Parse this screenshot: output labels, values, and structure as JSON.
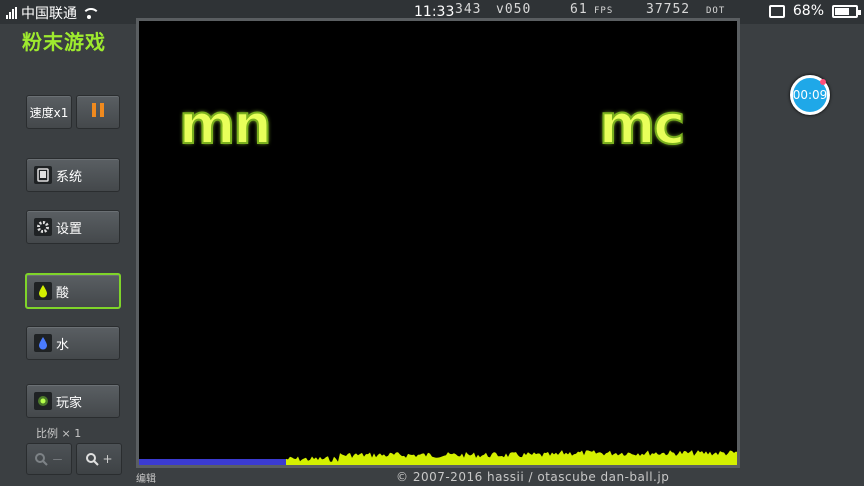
{
  "status_bar": {
    "carrier": "中国联通",
    "time": "11:33",
    "particles": "343",
    "version": "v050",
    "fps_value": "61",
    "fps_unit": "FPS",
    "dot_value": "37752",
    "dot_unit": "DOT",
    "battery": "68%"
  },
  "app": {
    "title": "粉末游戏"
  },
  "sidebar": {
    "speed_label": "速度x1",
    "system_label": "系统",
    "settings_label": "设置",
    "element_acid": "酸",
    "element_water": "水",
    "player_label": "玩家",
    "scale_label": "比例 × 1",
    "zoom_out": "－",
    "zoom_in": "+"
  },
  "canvas": {
    "text_left": "mn",
    "text_right": "mc"
  },
  "footer": {
    "edit_label": "编辑",
    "copyright": "© 2007-2016 hassii / otascube dan-ball.jp"
  },
  "overlay": {
    "timer": "00:09"
  },
  "colors": {
    "accent": "#9eea2e",
    "acid": "#d4f000",
    "water": "#3b3bd1",
    "timer": "#1fa8e8"
  },
  "icons": [
    "signal-icon",
    "wifi-icon",
    "cast-icon",
    "battery-icon",
    "pause-icon",
    "tablet-icon",
    "gear-icon",
    "acid-drop-icon",
    "water-drop-icon",
    "player-dot-icon",
    "zoom-out-icon",
    "zoom-in-icon"
  ]
}
